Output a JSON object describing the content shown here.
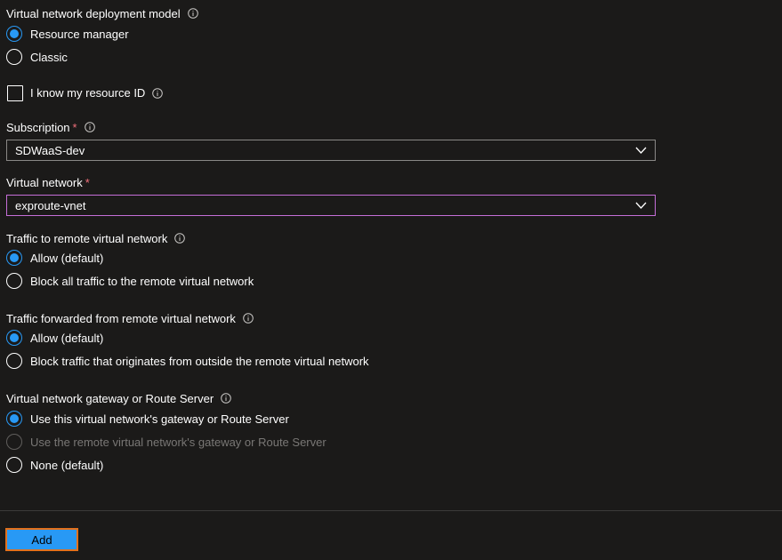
{
  "deployment_model": {
    "label": "Virtual network deployment model",
    "options": [
      {
        "label": "Resource manager",
        "checked": true
      },
      {
        "label": "Classic",
        "checked": false
      }
    ]
  },
  "resource_id": {
    "label": "I know my resource ID",
    "checked": false
  },
  "subscription": {
    "label": "Subscription",
    "required_mark": "*",
    "value": "SDWaaS-dev"
  },
  "virtual_network": {
    "label": "Virtual network",
    "required_mark": "*",
    "value": "exproute-vnet"
  },
  "traffic_to_remote": {
    "label": "Traffic to remote virtual network",
    "options": [
      {
        "label": "Allow (default)",
        "checked": true
      },
      {
        "label": "Block all traffic to the remote virtual network",
        "checked": false
      }
    ]
  },
  "traffic_forwarded": {
    "label": "Traffic forwarded from remote virtual network",
    "options": [
      {
        "label": "Allow (default)",
        "checked": true
      },
      {
        "label": "Block traffic that originates from outside the remote virtual network",
        "checked": false
      }
    ]
  },
  "gateway": {
    "label": "Virtual network gateway or Route Server",
    "options": [
      {
        "label": "Use this virtual network's gateway or Route Server",
        "checked": true,
        "disabled": false
      },
      {
        "label": "Use the remote virtual network's gateway or Route Server",
        "checked": false,
        "disabled": true
      },
      {
        "label": "None (default)",
        "checked": false,
        "disabled": false
      }
    ]
  },
  "footer": {
    "add_label": "Add"
  },
  "colors": {
    "background": "#1b1a19",
    "accent": "#2899f5",
    "focus_border": "#c56ed8",
    "required": "#f1707b",
    "button_outline": "#e2711d"
  }
}
